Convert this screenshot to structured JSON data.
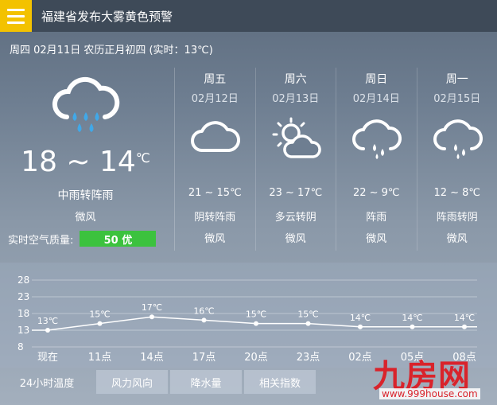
{
  "header": {
    "title": "福建省发布大雾黄色预警",
    "menu_icon": "menu-icon"
  },
  "datebar": {
    "text": "周四 02月11日 农历正月初四 (实时：13℃)"
  },
  "today": {
    "icon": "moderate-rain-icon",
    "temp_range": "18 ~ 14",
    "temp_unit": "℃",
    "condition": "中雨转阵雨",
    "wind": "微风",
    "aqi_label": "实时空气质量:",
    "aqi_value": "50 优",
    "aqi_color": "#3cc23e"
  },
  "forecast": [
    {
      "day": "周五",
      "date": "02月12日",
      "icon": "cloudy-icon",
      "temp": "21 ~ 15℃",
      "condition": "阴转阵雨",
      "wind": "微风"
    },
    {
      "day": "周六",
      "date": "02月13日",
      "icon": "partly-cloudy-icon",
      "temp": "23 ~ 17℃",
      "condition": "多云转阴",
      "wind": "微风"
    },
    {
      "day": "周日",
      "date": "02月14日",
      "icon": "showers-icon",
      "temp": "22 ~ 9℃",
      "condition": "阵雨",
      "wind": "微风"
    },
    {
      "day": "周一",
      "date": "02月15日",
      "icon": "showers-icon",
      "temp": "12 ~ 8℃",
      "condition": "阵雨转阴",
      "wind": "微风"
    }
  ],
  "chart_data": {
    "type": "line",
    "categories": [
      "现在",
      "11点",
      "14点",
      "17点",
      "20点",
      "23点",
      "02点",
      "05点",
      "08点"
    ],
    "series": [
      {
        "values": [
          13,
          15,
          17,
          16,
          15,
          15,
          14,
          14,
          14
        ]
      }
    ],
    "data_labels": [
      "13℃",
      "15℃",
      "17℃",
      "16℃",
      "15℃",
      "15℃",
      "14℃",
      "14℃",
      "14℃"
    ],
    "yticks": [
      8,
      13,
      18,
      23,
      28
    ],
    "ylim": [
      8,
      28
    ]
  },
  "tabs": [
    "24小时温度",
    "风力风向",
    "降水量",
    "相关指数"
  ],
  "watermark": {
    "logo_text": "九房网",
    "url": "www.999house.com"
  }
}
